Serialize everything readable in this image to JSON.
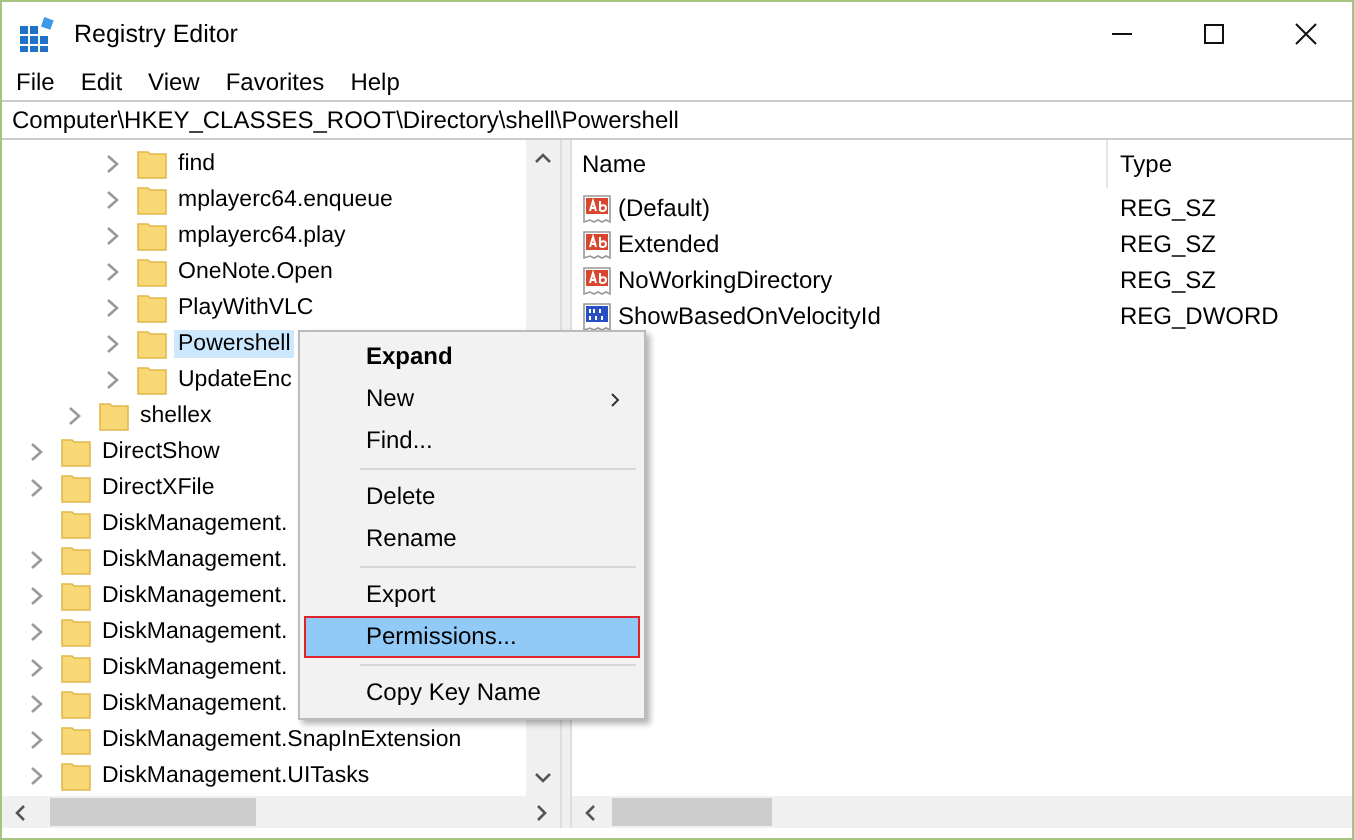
{
  "window": {
    "title": "Registry Editor"
  },
  "menu_bar": [
    "File",
    "Edit",
    "View",
    "Favorites",
    "Help"
  ],
  "address_bar": {
    "value": "Computer\\HKEY_CLASSES_ROOT\\Directory\\shell\\Powershell"
  },
  "tree": {
    "items": [
      {
        "children": [
          {
            "children": [
              {
                "label": "find",
                "expandable": true,
                "selected": false
              },
              {
                "label": "mplayerc64.enqueue",
                "expandable": true,
                "selected": false
              },
              {
                "label": "mplayerc64.play",
                "expandable": true,
                "selected": false
              },
              {
                "label": "OneNote.Open",
                "expandable": true,
                "selected": false
              },
              {
                "label": "PlayWithVLC",
                "expandable": true,
                "selected": false
              },
              {
                "label": "Powershell",
                "expandable": true,
                "selected": true
              },
              {
                "label": "UpdateEnc",
                "expandable": true,
                "selected": false
              }
            ]
          },
          {
            "label": "shellex",
            "expandable": true,
            "selected": false
          }
        ]
      },
      {
        "label": "DirectShow",
        "expandable": true,
        "selected": false
      },
      {
        "label": "DirectXFile",
        "expandable": true,
        "selected": false
      },
      {
        "label": "DiskManagement.",
        "expandable": false,
        "selected": false
      },
      {
        "label": "DiskManagement.",
        "expandable": true,
        "selected": false
      },
      {
        "label": "DiskManagement.",
        "expandable": true,
        "selected": false
      },
      {
        "label": "DiskManagement.",
        "expandable": true,
        "selected": false
      },
      {
        "label": "DiskManagement.",
        "expandable": true,
        "selected": false
      },
      {
        "label": "DiskManagement.",
        "expandable": true,
        "selected": false
      },
      {
        "label": "DiskManagement.SnapInExtension",
        "expandable": true,
        "selected": false
      },
      {
        "label": "DiskManagement.UITasks",
        "expandable": true,
        "selected": false
      }
    ]
  },
  "values": {
    "columns": [
      "Name",
      "Type"
    ],
    "rows": [
      {
        "kind": "string",
        "name": "(Default)",
        "type": "REG_SZ"
      },
      {
        "kind": "string",
        "name": "Extended",
        "type": "REG_SZ"
      },
      {
        "kind": "string",
        "name": "NoWorkingDirectory",
        "type": "REG_SZ"
      },
      {
        "kind": "dword",
        "name": "ShowBasedOnVelocityId",
        "type": "REG_DWORD"
      }
    ]
  },
  "context_menu": {
    "items": [
      {
        "kind": "item",
        "label": "Expand",
        "default": true,
        "submenu": false,
        "selected": false
      },
      {
        "kind": "item",
        "label": "New",
        "default": false,
        "submenu": true,
        "selected": false
      },
      {
        "kind": "item",
        "label": "Find...",
        "default": false,
        "submenu": false,
        "selected": false
      },
      {
        "kind": "separator"
      },
      {
        "kind": "item",
        "label": "Delete",
        "default": false,
        "submenu": false,
        "selected": false
      },
      {
        "kind": "item",
        "label": "Rename",
        "default": false,
        "submenu": false,
        "selected": false
      },
      {
        "kind": "separator"
      },
      {
        "kind": "item",
        "label": "Export",
        "default": false,
        "submenu": false,
        "selected": false
      },
      {
        "kind": "item",
        "label": "Permissions...",
        "default": false,
        "submenu": false,
        "selected": true
      },
      {
        "kind": "separator"
      },
      {
        "kind": "item",
        "label": "Copy Key Name",
        "default": false,
        "submenu": false,
        "selected": false
      }
    ]
  }
}
